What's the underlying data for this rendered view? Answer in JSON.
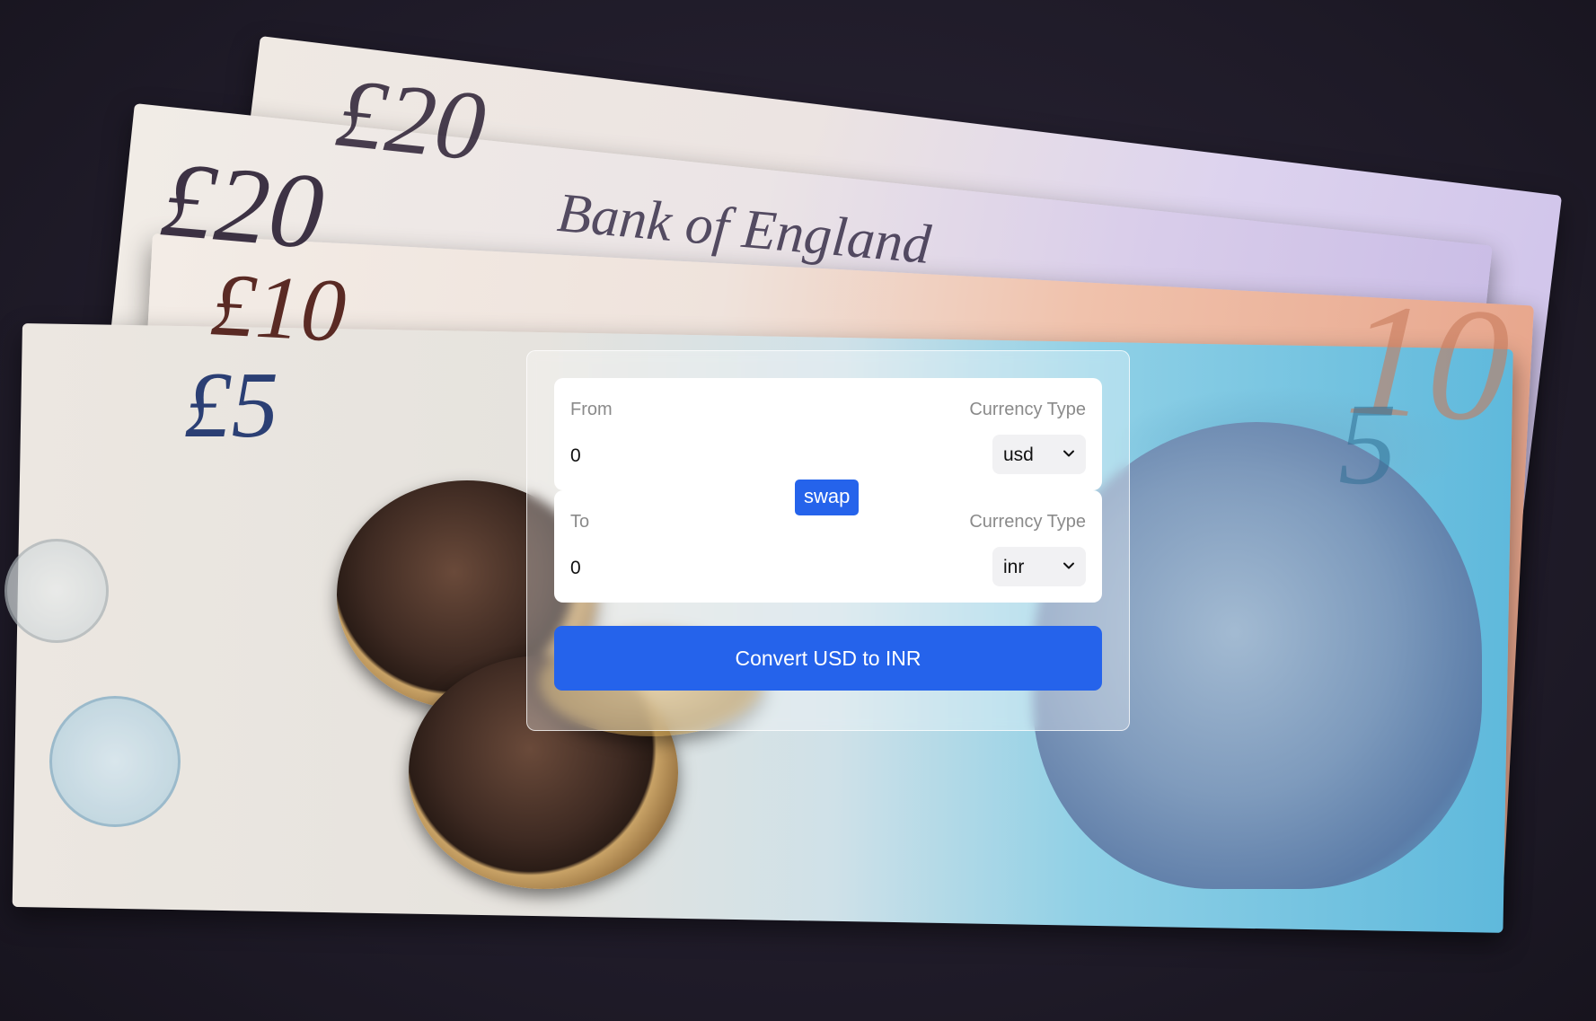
{
  "converter": {
    "from": {
      "label": "From",
      "currency_label": "Currency Type",
      "amount": "0",
      "currency": "usd"
    },
    "to": {
      "label": "To",
      "currency_label": "Currency Type",
      "amount": "0",
      "currency": "inr"
    },
    "swap_label": "swap",
    "convert_label": "Convert USD to INR",
    "accent_color": "#2563eb"
  },
  "background": {
    "note_texts": [
      "£20",
      "£20",
      "£10",
      "£5",
      "10",
      "5"
    ],
    "bank_text": "Bank of England"
  }
}
